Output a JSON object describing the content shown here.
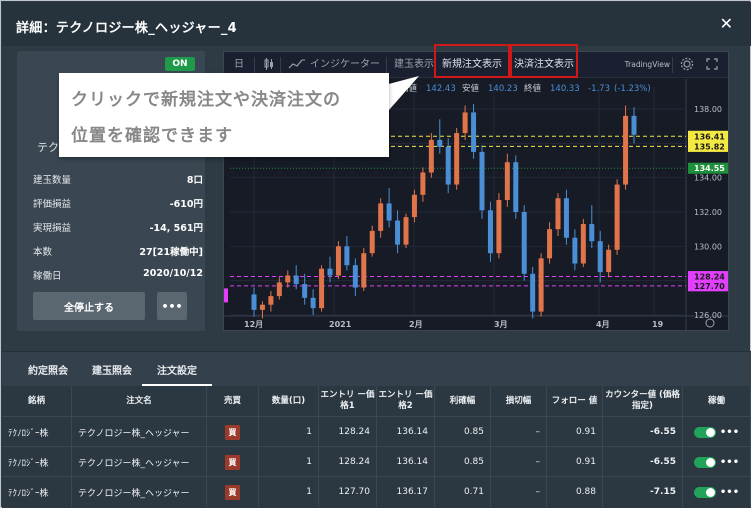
{
  "window": {
    "title": "詳細：テクノロジー株_ヘッジャー_4"
  },
  "strategy": {
    "status_badge": "ON",
    "name_visible": "テク",
    "stats": [
      {
        "label": "建玉数量",
        "value": "8口"
      },
      {
        "label": "評価損益",
        "value": "-610円"
      },
      {
        "label": "実現損益",
        "value": "-14, 561円"
      },
      {
        "label": "本数",
        "value": "27[21稼働中]"
      },
      {
        "label": "稼働日",
        "value": "2020/10/12"
      }
    ],
    "stop_all_label": "全停止する",
    "more_label": "•••"
  },
  "chart_toolbar": {
    "calendar_label": "日",
    "indicator_label": "インジケーター",
    "position_label": "建玉表示",
    "new_order_label": "新規注文表示",
    "close_order_label": "決済注文表示",
    "brand": "TradingView"
  },
  "callout": {
    "line1": "クリックで新規注文や決済注文の",
    "line2": "位置を確認できます"
  },
  "chart_data": {
    "type": "candlestick",
    "ohlc_header": {
      "high_label": "高値",
      "high": "142.43",
      "low_label": "安値",
      "low": "140.23",
      "close_label": "終値",
      "close": "140.33",
      "change": "-1.73",
      "change_pct": "(-1.23%)"
    },
    "y_ticks": [
      "138.00",
      "134.00",
      "132.00",
      "130.00",
      "128.00",
      "126.00"
    ],
    "x_ticks": [
      "12月",
      "2021",
      "2月",
      "3月",
      "4月",
      "19"
    ],
    "ylim": [
      126,
      138
    ],
    "price_lines": [
      {
        "value": 136.41,
        "label": "136.41",
        "color": "#f4e842",
        "kind": "close-order"
      },
      {
        "value": 135.82,
        "label": "135.82",
        "color": "#f4e842",
        "kind": "close-order"
      },
      {
        "value": 134.55,
        "label": "134.55",
        "color": "#1e8f3a",
        "kind": "current"
      },
      {
        "value": 128.24,
        "label": "128.24",
        "color": "#e040fb",
        "kind": "new-order"
      },
      {
        "value": 127.7,
        "label": "127.70",
        "color": "#e040fb",
        "kind": "new-order"
      }
    ],
    "candles": [
      {
        "o": 127.2,
        "h": 127.6,
        "l": 125.9,
        "c": 126.3
      },
      {
        "o": 126.3,
        "h": 126.8,
        "l": 125.8,
        "c": 126.6
      },
      {
        "o": 126.6,
        "h": 127.4,
        "l": 126.2,
        "c": 127.1
      },
      {
        "o": 127.1,
        "h": 128.2,
        "l": 126.9,
        "c": 127.9
      },
      {
        "o": 127.9,
        "h": 128.6,
        "l": 127.6,
        "c": 128.3
      },
      {
        "o": 128.3,
        "h": 128.9,
        "l": 127.5,
        "c": 127.8
      },
      {
        "o": 127.8,
        "h": 128.4,
        "l": 126.6,
        "c": 127.0
      },
      {
        "o": 127.0,
        "h": 127.5,
        "l": 126.0,
        "c": 126.4
      },
      {
        "o": 126.4,
        "h": 128.9,
        "l": 126.2,
        "c": 128.7
      },
      {
        "o": 128.7,
        "h": 129.4,
        "l": 127.9,
        "c": 128.3
      },
      {
        "o": 128.3,
        "h": 130.3,
        "l": 128.1,
        "c": 130.0
      },
      {
        "o": 130.0,
        "h": 130.6,
        "l": 128.6,
        "c": 128.9
      },
      {
        "o": 128.9,
        "h": 129.3,
        "l": 127.1,
        "c": 127.6
      },
      {
        "o": 127.6,
        "h": 129.9,
        "l": 127.4,
        "c": 129.6
      },
      {
        "o": 129.6,
        "h": 131.2,
        "l": 129.4,
        "c": 130.9
      },
      {
        "o": 130.9,
        "h": 132.8,
        "l": 130.5,
        "c": 132.5
      },
      {
        "o": 132.5,
        "h": 133.4,
        "l": 131.1,
        "c": 131.5
      },
      {
        "o": 131.5,
        "h": 132.1,
        "l": 129.6,
        "c": 130.1
      },
      {
        "o": 130.1,
        "h": 131.9,
        "l": 129.9,
        "c": 131.7
      },
      {
        "o": 131.7,
        "h": 133.3,
        "l": 131.4,
        "c": 133.0
      },
      {
        "o": 133.0,
        "h": 134.6,
        "l": 132.6,
        "c": 134.3
      },
      {
        "o": 134.3,
        "h": 136.6,
        "l": 134.0,
        "c": 136.2
      },
      {
        "o": 136.2,
        "h": 137.4,
        "l": 135.4,
        "c": 135.8
      },
      {
        "o": 135.8,
        "h": 136.3,
        "l": 133.1,
        "c": 133.6
      },
      {
        "o": 133.6,
        "h": 136.9,
        "l": 133.3,
        "c": 136.6
      },
      {
        "o": 136.6,
        "h": 138.2,
        "l": 136.2,
        "c": 137.8
      },
      {
        "o": 137.8,
        "h": 138.3,
        "l": 135.1,
        "c": 135.5
      },
      {
        "o": 135.5,
        "h": 135.9,
        "l": 131.6,
        "c": 132.1
      },
      {
        "o": 132.1,
        "h": 132.6,
        "l": 129.1,
        "c": 129.6
      },
      {
        "o": 129.6,
        "h": 133.1,
        "l": 129.3,
        "c": 132.7
      },
      {
        "o": 132.7,
        "h": 135.4,
        "l": 132.3,
        "c": 134.9
      },
      {
        "o": 134.9,
        "h": 135.3,
        "l": 131.6,
        "c": 132.0
      },
      {
        "o": 132.0,
        "h": 132.4,
        "l": 128.0,
        "c": 128.4
      },
      {
        "o": 128.4,
        "h": 128.8,
        "l": 125.8,
        "c": 126.2
      },
      {
        "o": 126.2,
        "h": 129.6,
        "l": 125.9,
        "c": 129.3
      },
      {
        "o": 129.3,
        "h": 131.4,
        "l": 129.0,
        "c": 131.0
      },
      {
        "o": 131.0,
        "h": 133.1,
        "l": 130.6,
        "c": 132.8
      },
      {
        "o": 132.8,
        "h": 133.3,
        "l": 130.1,
        "c": 130.5
      },
      {
        "o": 130.5,
        "h": 131.0,
        "l": 128.6,
        "c": 129.0
      },
      {
        "o": 129.0,
        "h": 131.6,
        "l": 128.8,
        "c": 131.3
      },
      {
        "o": 131.3,
        "h": 132.4,
        "l": 129.9,
        "c": 130.3
      },
      {
        "o": 130.3,
        "h": 130.9,
        "l": 127.9,
        "c": 128.5
      },
      {
        "o": 128.5,
        "h": 130.1,
        "l": 128.2,
        "c": 129.8
      },
      {
        "o": 129.8,
        "h": 133.9,
        "l": 129.5,
        "c": 133.6
      },
      {
        "o": 133.6,
        "h": 138.2,
        "l": 133.3,
        "c": 137.6
      },
      {
        "o": 137.6,
        "h": 138.1,
        "l": 136.0,
        "c": 136.5
      }
    ]
  },
  "tabs": [
    "約定照会",
    "建玉照会",
    "注文設定"
  ],
  "table": {
    "headers": [
      "銘柄",
      "注文名",
      "売買",
      "数量(口)",
      "エントリ ー価格1",
      "エントリ ー価格2",
      "利確幅",
      "損切幅",
      "フォロー 値",
      "カウンター値 (価格指定)",
      "稼働"
    ],
    "rows": [
      {
        "symbol": "ﾃｸﾉﾛｼﾞｰ株",
        "name": "テクノロジー株_ヘッジャー",
        "side": "買",
        "qty": "1",
        "entry1": "128.24",
        "entry2": "136.14",
        "take_profit": "0.85",
        "stop_loss": "–",
        "follow": "0.91",
        "counter": "-6.55"
      },
      {
        "symbol": "ﾃｸﾉﾛｼﾞｰ株",
        "name": "テクノロジー株_ヘッジャー",
        "side": "買",
        "qty": "1",
        "entry1": "128.24",
        "entry2": "136.14",
        "take_profit": "0.85",
        "stop_loss": "–",
        "follow": "0.91",
        "counter": "-6.55"
      },
      {
        "symbol": "ﾃｸﾉﾛｼﾞｰ株",
        "name": "テクノロジー株_ヘッジャー",
        "side": "買",
        "qty": "1",
        "entry1": "127.70",
        "entry2": "136.17",
        "take_profit": "0.71",
        "stop_loss": "–",
        "follow": "0.88",
        "counter": "-7.15"
      }
    ]
  }
}
